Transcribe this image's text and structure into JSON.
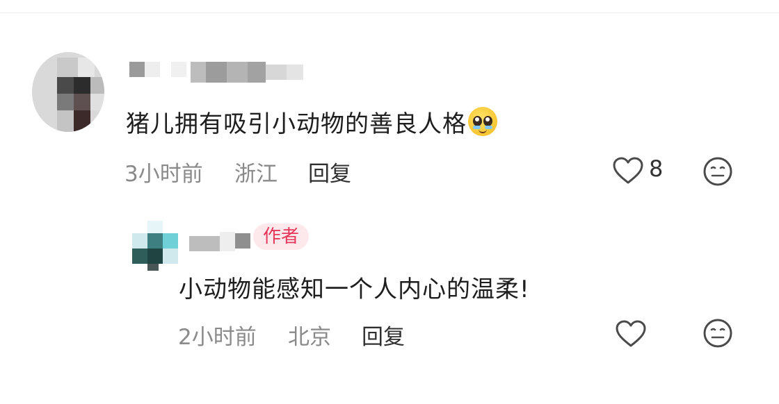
{
  "comment": {
    "text": "猪儿拥有吸引小动物的善良人格",
    "emoji": "pleading-face-emoji",
    "time": "3小时前",
    "location": "浙江",
    "reply_label": "回复",
    "like_count": "8"
  },
  "reply": {
    "badge": "作者",
    "text": "小动物能感知一个人内心的温柔!",
    "time": "2小时前",
    "location": "北京",
    "reply_label": "回复"
  },
  "icons": {
    "like": "heart-outline-icon",
    "dislike": "neutral-face-icon"
  },
  "colors": {
    "badge_text": "#e8365a",
    "badge_bg": "#fde9ec",
    "meta_text": "#8a8a8a"
  }
}
